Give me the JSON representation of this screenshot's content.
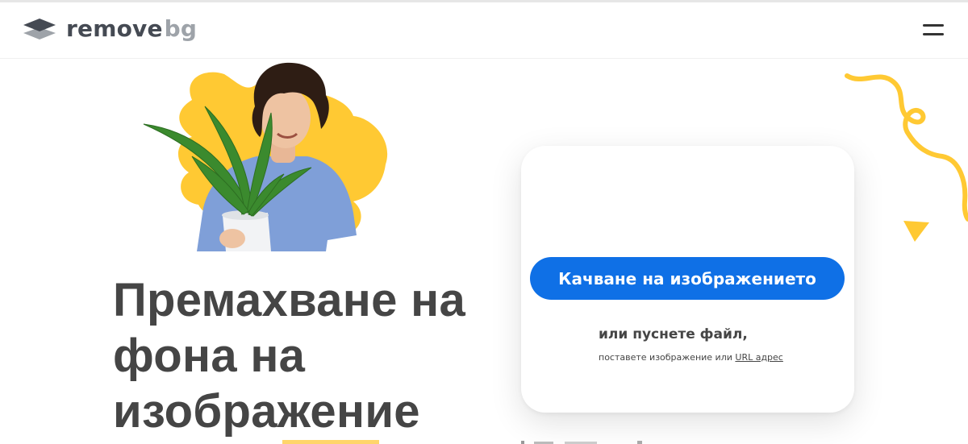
{
  "brand": {
    "name_part1": "remove",
    "name_part2": "bg",
    "icon": "stacked-layers-logo-icon"
  },
  "header": {
    "menu_icon": "hamburger-menu-icon"
  },
  "hero": {
    "image": "man-holding-plant-on-yellow-blob",
    "title_line1": "Премахване на",
    "title_line2": "фона на",
    "title_line3": "изображение"
  },
  "upload": {
    "button_label": "Качване на изображението",
    "drop_label": "или пуснете файл,",
    "paste_prefix": "поставете изображение или ",
    "url_link": "URL адрес"
  },
  "colors": {
    "primary": "#0f70e6",
    "accent_yellow": "#ffc933",
    "heading_text": "#454545",
    "logo_dark": "#454a53",
    "logo_light": "#9ea3a9"
  }
}
